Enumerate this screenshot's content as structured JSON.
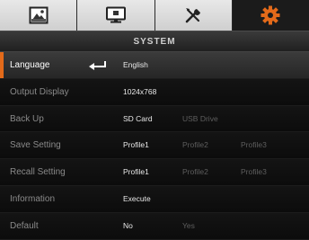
{
  "tabs": [
    {
      "name": "image-icon",
      "active": false
    },
    {
      "name": "display-icon",
      "active": false
    },
    {
      "name": "tools-icon",
      "active": false
    },
    {
      "name": "gear-icon",
      "active": true
    }
  ],
  "accent_color": "#e36a1a",
  "title": "SYSTEM",
  "rows": [
    {
      "label": "Language",
      "selected": true,
      "options": [
        "English"
      ]
    },
    {
      "label": "Output Display",
      "options": [
        "1024x768"
      ]
    },
    {
      "label": "Back Up",
      "options": [
        "SD Card",
        "USB Drive"
      ]
    },
    {
      "label": "Save Setting",
      "options": [
        "Profile1",
        "Profile2",
        "Profile3"
      ]
    },
    {
      "label": "Recall Setting",
      "options": [
        "Profile1",
        "Profile2",
        "Profile3"
      ]
    },
    {
      "label": "Information",
      "options": [
        "Execute"
      ]
    },
    {
      "label": "Default",
      "options": [
        "No",
        "Yes"
      ]
    }
  ]
}
